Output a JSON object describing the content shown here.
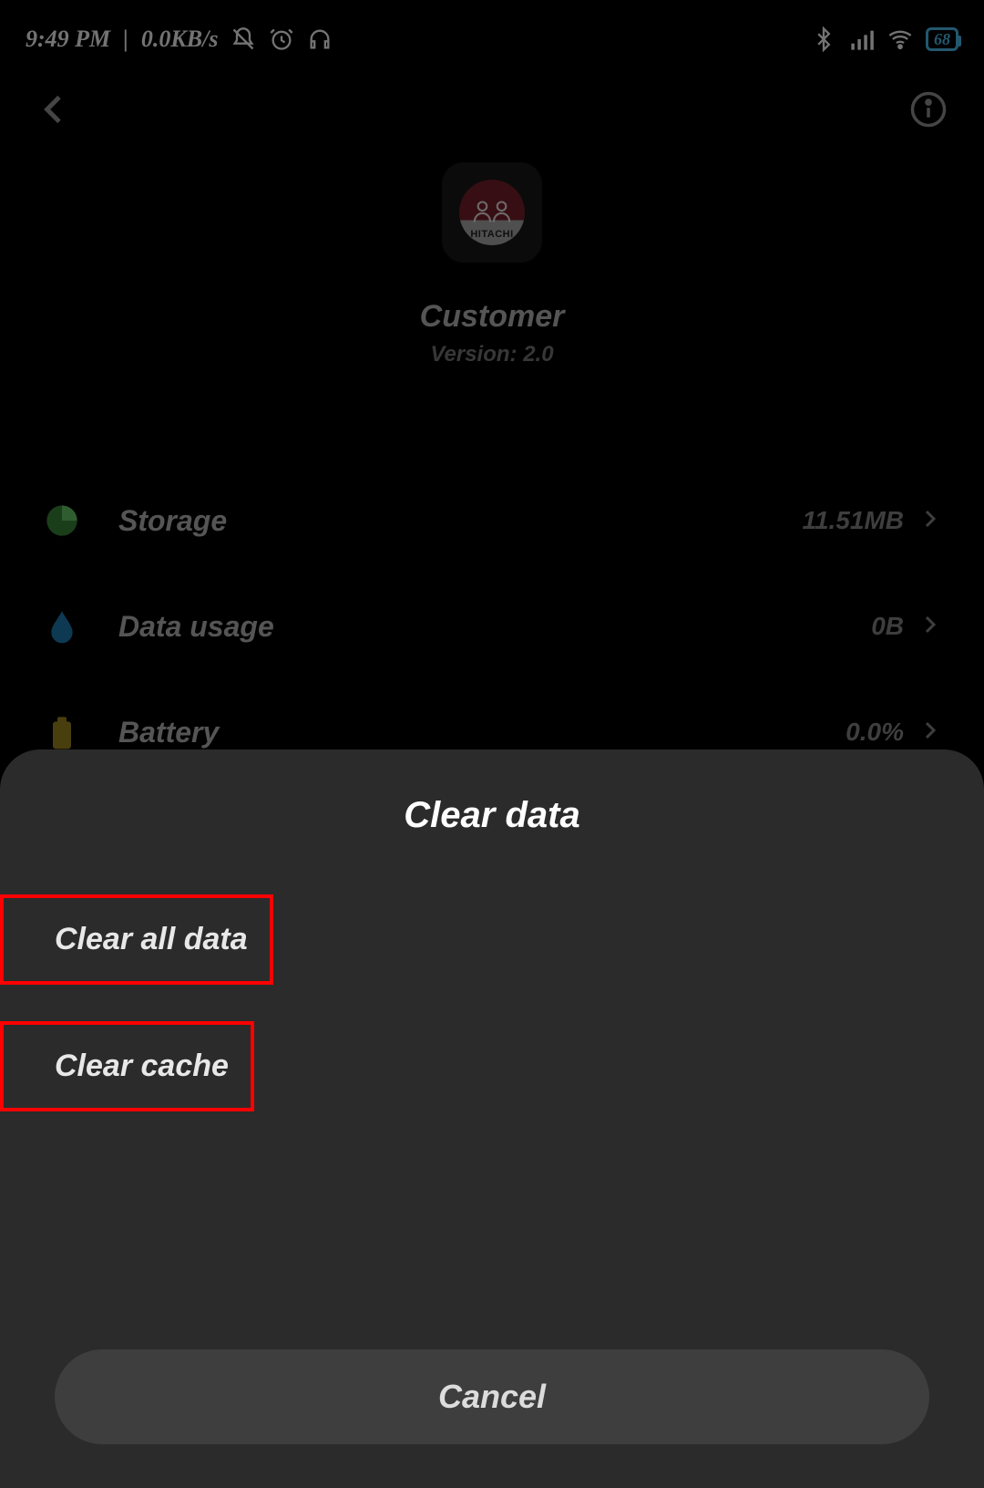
{
  "statusbar": {
    "time": "9:49 PM",
    "net_speed": "0.0KB/s",
    "battery_percent": "68"
  },
  "app": {
    "name": "Customer",
    "version_label": "Version: 2.0",
    "brand": "HITACHI"
  },
  "list": {
    "storage": {
      "label": "Storage",
      "value": "11.51MB"
    },
    "data": {
      "label": "Data usage",
      "value": "0B"
    },
    "battery": {
      "label": "Battery",
      "value": "0.0%"
    }
  },
  "sheet": {
    "title": "Clear data",
    "option_clear_all": "Clear all data",
    "option_clear_cache": "Clear cache",
    "cancel": "Cancel"
  }
}
